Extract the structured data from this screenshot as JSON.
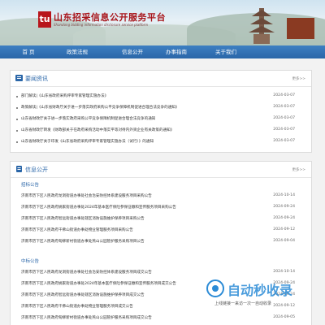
{
  "header": {
    "logo_text": "tu",
    "site_title": "山东招采信息公开服务平台",
    "site_subtitle": "Shandong bidding information disclosure service platform"
  },
  "nav": {
    "items": [
      {
        "label": "首 页"
      },
      {
        "label": "政策法规"
      },
      {
        "label": "信息公开"
      },
      {
        "label": "办事指南"
      },
      {
        "label": "关于我们"
      }
    ]
  },
  "news": {
    "title": "要闻资讯",
    "more": "更多>>",
    "rows": [
      {
        "title": "部门解读|《山东省政府采购评审专家管理实施办法》",
        "date": "2024-03-07"
      },
      {
        "title": "政策解读|《山东省财政厅关于进一步落实政府采购公平竞争保障机制促进合理合法竞争的通知》",
        "date": "2024-03-07"
      },
      {
        "title": "山东省财政厅关于进一步落实政府采购公平竞争保障机制促进合理合法竞争的通知",
        "date": "2024-03-07"
      },
      {
        "title": "山东省财政厅转发《财政部关于在政府采购活动中落实平等对待内外资企业有关政策的通知》",
        "date": "2024-03-07"
      },
      {
        "title": "山东省财政厅关于印发《山东省政府采购评审专家管理实施办法（试行）》的通知",
        "date": "2024-03-07"
      }
    ]
  },
  "info": {
    "title": "信息公开",
    "more": "更多>>",
    "bid_label": "招标公告",
    "bid_rows": [
      {
        "title": "济南市历下区人民政府龙洞街道办事处社会治安防控体系建设服务项目采购公告",
        "date": "2024-10-14"
      },
      {
        "title": "济南市历下区人民政府姚家街道办事处2024年基本医疗保险参保征缴和宣传服务项目采购公告",
        "date": "2024-09-24"
      },
      {
        "title": "济南市历下区人民政府智远街道办事处辖区消防设施维护保养项目采购公告",
        "date": "2024-09-24"
      },
      {
        "title": "济南市历下区人民政府千佛山街道办事处物业管理服务项目采购公告",
        "date": "2024-09-12"
      },
      {
        "title": "济南市历下区人民政府甸柳新村街道办事处燕山公园管护服务采购项目公告",
        "date": "2024-09-04"
      }
    ],
    "win_label": "中标公告",
    "win_rows": [
      {
        "title": "济南市历下区人民政府龙洞街道办事处社会治安防控体系建设服务项目成交公告",
        "date": "2024-10-14"
      },
      {
        "title": "济南市历下区人民政府姚家街道办事处2024年基本医疗保险参保征缴和宣传服务项目成交公告",
        "date": "2024-09-24"
      },
      {
        "title": "济南市历下区人民政府智远街道办事处辖区消防设施维护保养项目成交公告",
        "date": "2024-09-24"
      },
      {
        "title": "济南市历下区人民政府千佛山街道办事处物业管理服务项目成交公告",
        "date": "2024-09-12"
      },
      {
        "title": "济南市历下区人民政府甸柳新村街道办事处燕山公园管护服务采购项目成交公告",
        "date": "2024-09-05"
      }
    ]
  },
  "watermark": {
    "title": "自动秒收录",
    "subtitle": "上线链接一来访一次一自动收录"
  }
}
